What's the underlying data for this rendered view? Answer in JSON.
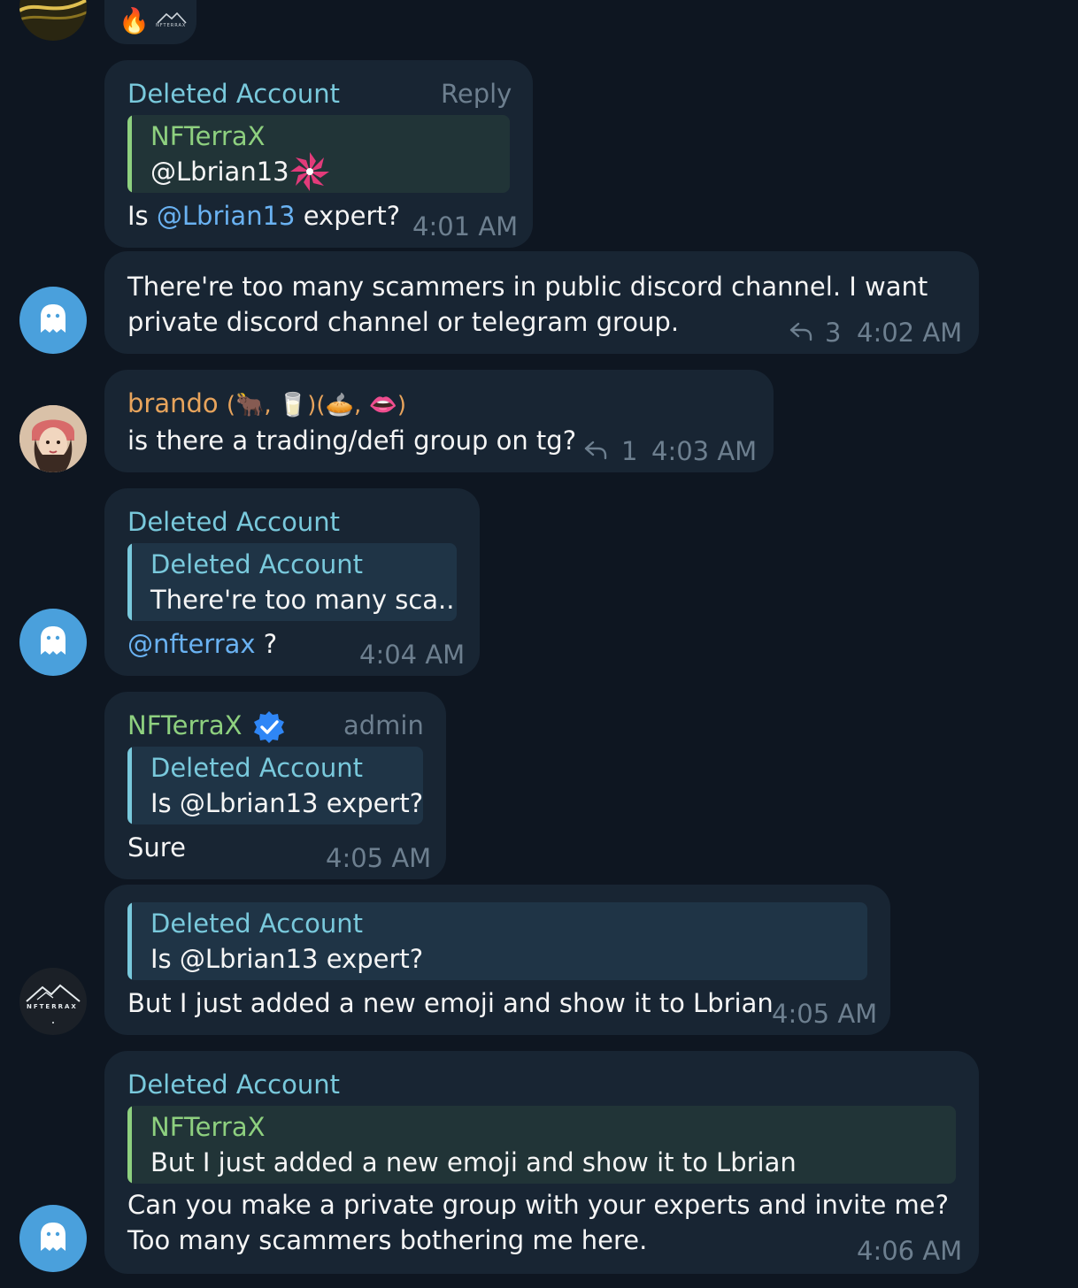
{
  "top_reactions": {
    "fire": "🔥",
    "logo_text": "NFTERRAX"
  },
  "messages": [
    {
      "name": "Deleted Account",
      "tag": "Reply",
      "quote": {
        "name": "NFTerraX",
        "text": "@Lbrian13"
      },
      "text_mention": "@Lbrian13",
      "text_before": "Is ",
      "text_after": " expert?",
      "time": "4:01 AM"
    },
    {
      "text_line1": "There're too many scammers in public discord channel. I want",
      "text_line2": "private discord channel or telegram group.",
      "reply_count": "3",
      "time": "4:02 AM"
    },
    {
      "name": "brando",
      "name_emojis": "(🐂, 🥛)(🥧, 👄)",
      "text": "is there a trading/defi group on tg?",
      "reply_count": "1",
      "time": "4:03 AM"
    },
    {
      "name": "Deleted Account",
      "quote": {
        "name": "Deleted Account",
        "text": "There're too many sca..."
      },
      "mention": "@nfterrax",
      "text_after": " ?",
      "time": "4:04 AM"
    },
    {
      "name": "NFTerraX",
      "tag": "admin",
      "quote": {
        "name": "Deleted Account",
        "text": "Is @Lbrian13 expert?"
      },
      "text": "Sure",
      "time": "4:05 AM"
    },
    {
      "quote": {
        "name": "Deleted Account",
        "text": "Is @Lbrian13 expert?"
      },
      "text": "But I just added a new emoji and show it to Lbrian",
      "time": "4:05 AM",
      "avatar_text": "NFTERRAX"
    },
    {
      "name": "Deleted Account",
      "quote": {
        "name": "NFTerraX",
        "text": "But I just added a new emoji and show it to Lbrian"
      },
      "text_line1": "Can you make a private group with your experts and invite me?",
      "text_line2": "Too many scammers bothering me here.",
      "time": "4:06 AM"
    }
  ],
  "colors": {
    "background": "#0e1621",
    "bubble": "#182533",
    "name_teal": "#79c9dc",
    "name_green": "#8ed07f",
    "name_orange": "#e8a45c",
    "mention": "#6ab2f2",
    "verified": "#2f86f6"
  }
}
